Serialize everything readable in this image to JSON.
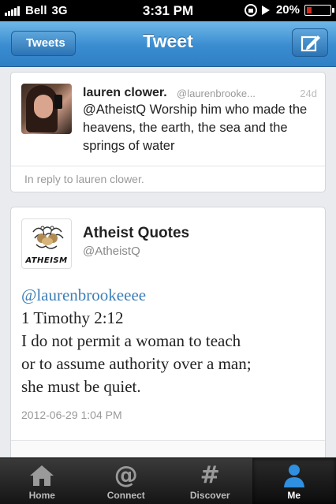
{
  "status_bar": {
    "carrier": "Bell",
    "network": "3G",
    "time": "3:31 PM",
    "battery": "20%",
    "battery_level": 0.2
  },
  "nav": {
    "back_label": "Tweets",
    "title": "Tweet",
    "compose_icon": "compose-icon"
  },
  "reply_tweet": {
    "name": "lauren clower.",
    "handle": "@laurenbrooke...",
    "age": "24d",
    "text": "@AtheistQ Worship him who made the heavens, the earth, the sea and the springs of water",
    "reply_note": "In reply to lauren clower."
  },
  "main_tweet": {
    "name": "Atheist Quotes",
    "handle": "@AtheistQ",
    "avatar_label": "ATHEISM",
    "mention": "@laurenbrookeeee",
    "lines": [
      "1 Timothy 2:12",
      "I do not permit a woman to teach",
      "or to assume authority over a man;",
      "she must be quiet."
    ],
    "date": "2012-06-29 1:04 PM"
  },
  "tabs": [
    {
      "label": "Home",
      "icon": "home-icon",
      "active": false
    },
    {
      "label": "Connect",
      "icon": "at-icon",
      "active": false
    },
    {
      "label": "Discover",
      "icon": "hash-icon",
      "active": false
    },
    {
      "label": "Me",
      "icon": "person-icon",
      "active": true
    }
  ],
  "colors": {
    "nav_blue": "#3a8cd0",
    "link_blue": "#3d7fb8",
    "active_tab_blue": "#2f8fe0"
  }
}
